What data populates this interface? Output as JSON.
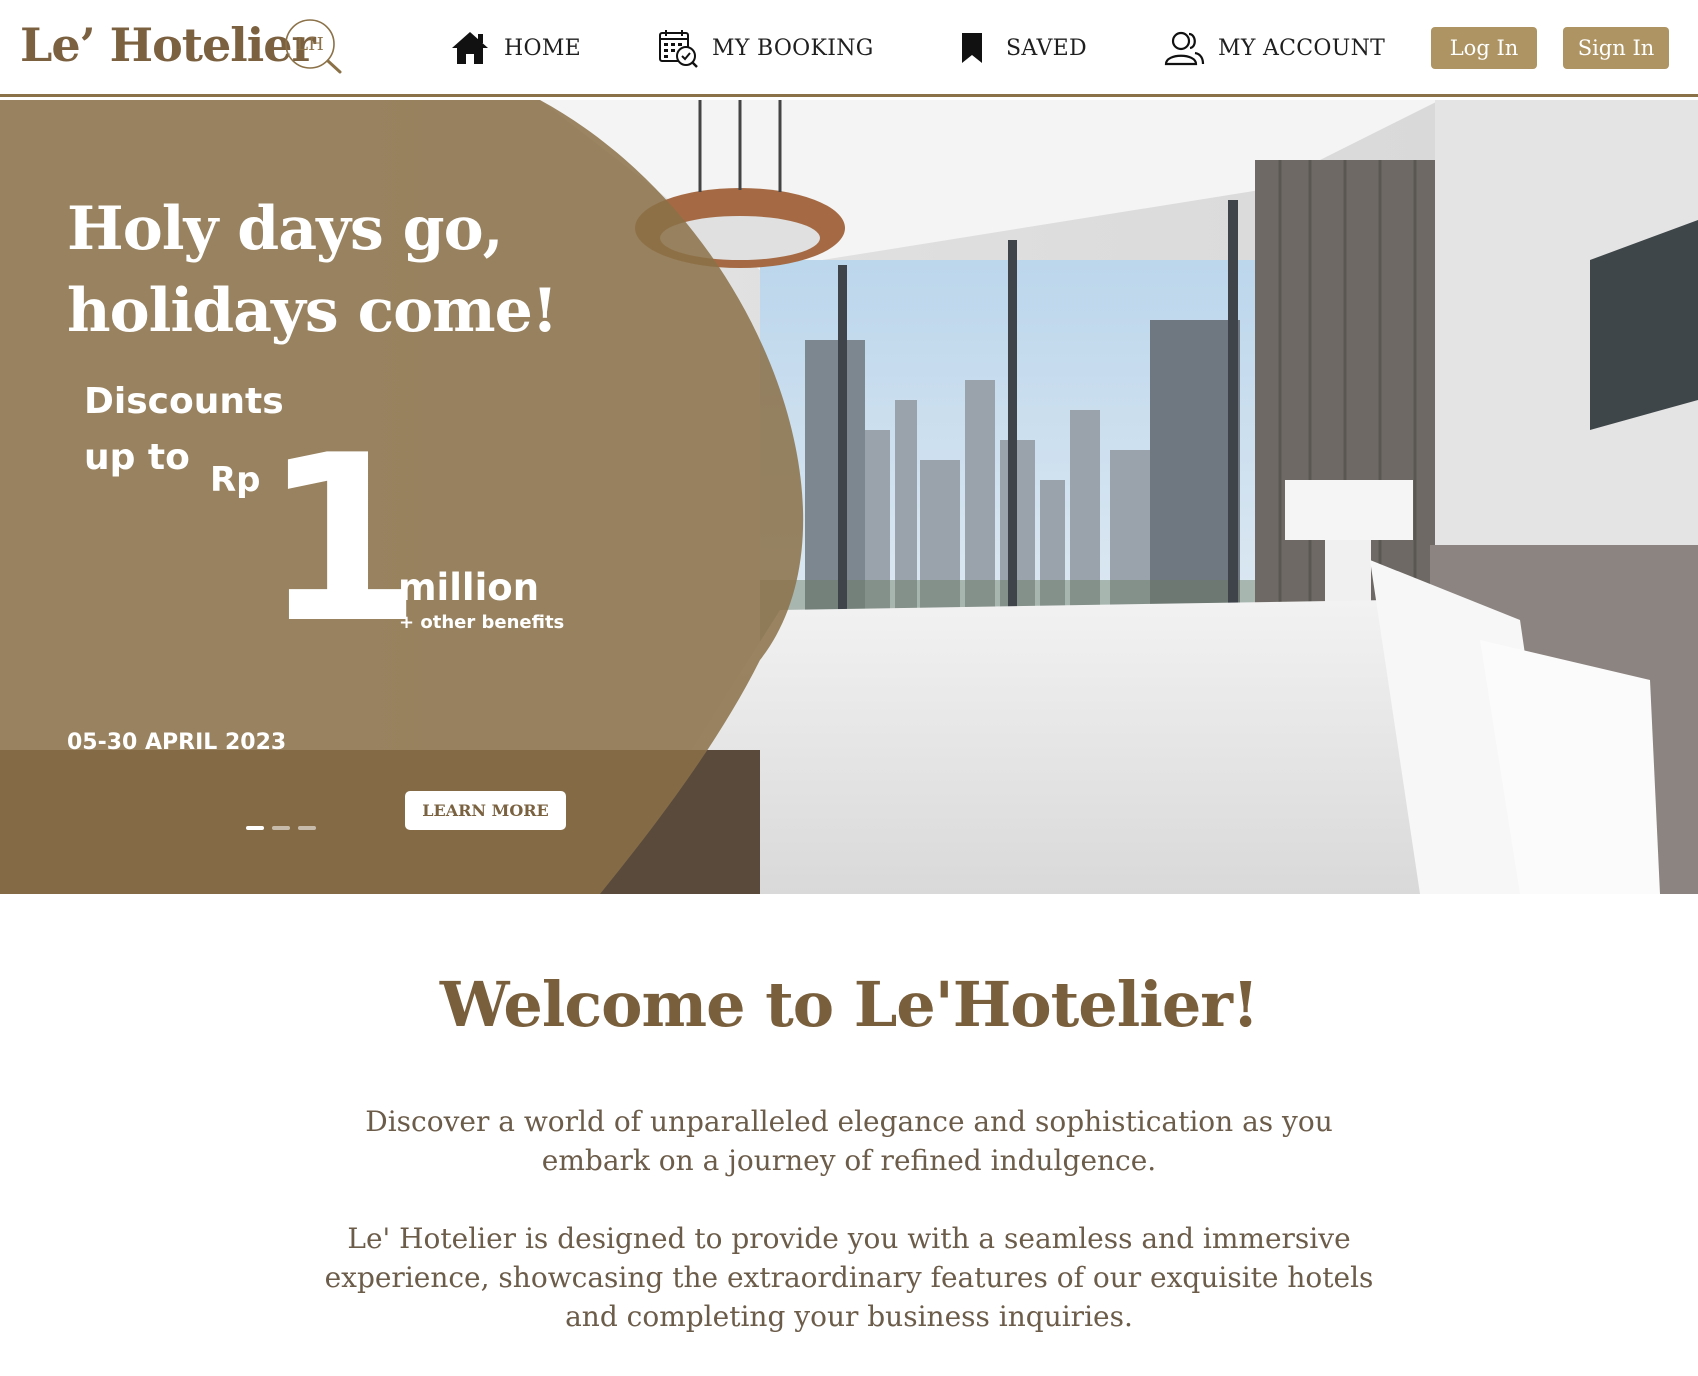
{
  "brand": {
    "name": "Le’ Hotelier",
    "logo_monogram": "LH"
  },
  "nav": {
    "home": {
      "label": "HOME",
      "icon": "home-icon"
    },
    "booking": {
      "label": "MY BOOKING",
      "icon": "calendar-check-icon"
    },
    "saved": {
      "label": "SAVED",
      "icon": "bookmark-icon"
    },
    "account": {
      "label": "MY ACCOUNT",
      "icon": "users-icon"
    }
  },
  "auth": {
    "login_label": "Log In",
    "signin_label": "Sign In"
  },
  "hero": {
    "headline_line1": "Holy days go,",
    "headline_line2": "holidays come!",
    "discount_line1": "Discounts",
    "discount_line2": "up to",
    "currency": "Rp",
    "amount": "1",
    "unit": "million",
    "benefits": "+ other benefits",
    "dates": "05-30 APRIL 2023",
    "cta_label": "LEARN MORE",
    "slides_total": 3,
    "active_slide": 1
  },
  "welcome": {
    "title": "Welcome to Le'Hotelier!",
    "paragraph1": "Discover a world of unparalleled elegance and sophistication as you embark on a journey of refined indulgence.",
    "paragraph2": "Le' Hotelier is designed to provide you with a seamless and immersive experience, showcasing the extraordinary features of our exquisite hotels and completing your business inquiries."
  },
  "colors": {
    "brand_gold": "#ae9463",
    "brand_brown": "#7a5f3c",
    "overlay": "#8b7148"
  }
}
